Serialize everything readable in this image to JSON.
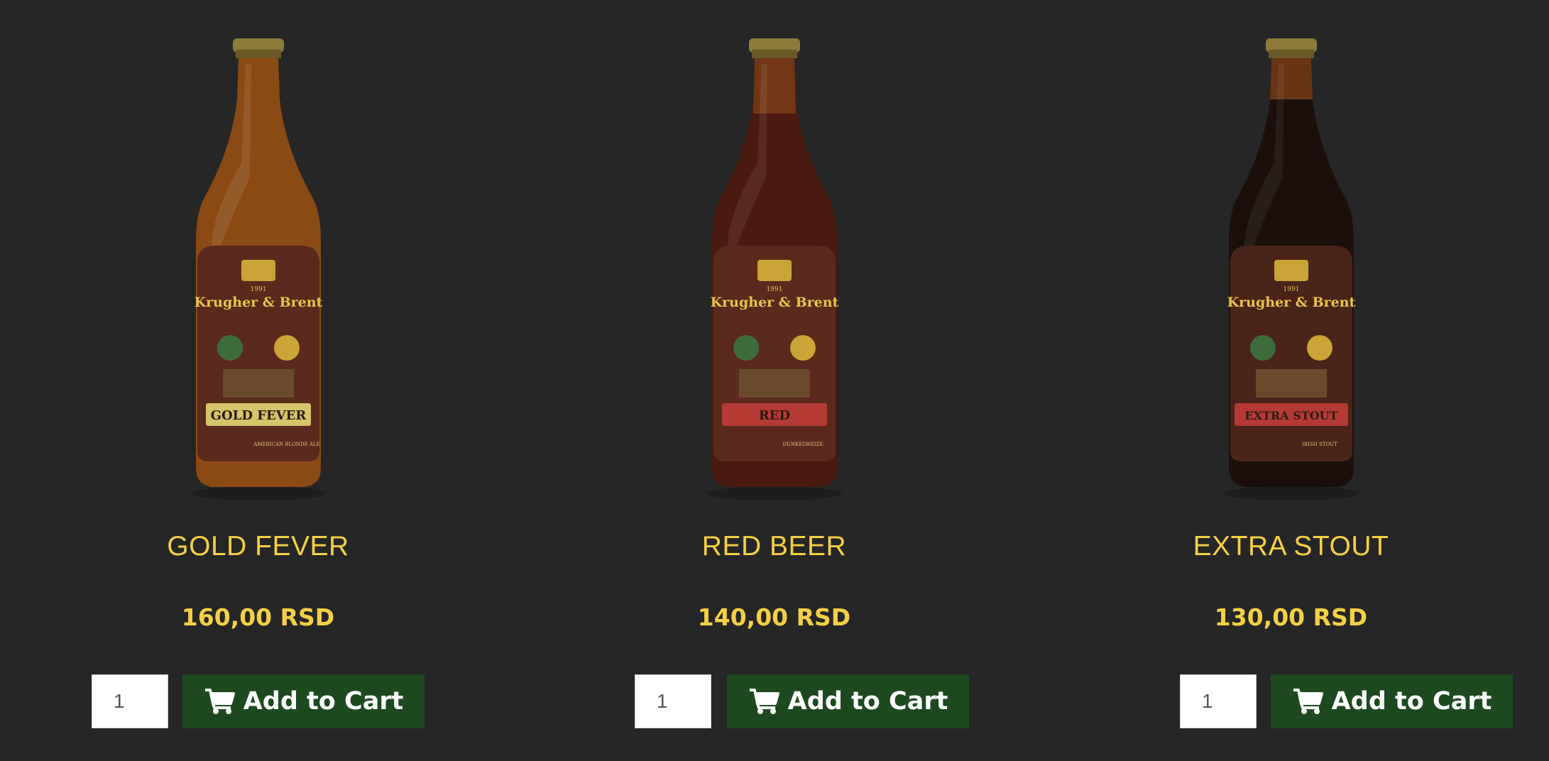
{
  "products": [
    {
      "name": "GOLD FEVER",
      "price": "160,00 RSD",
      "quantity": "1",
      "button_label": "Add to Cart",
      "bottle_color": "#8a4a14",
      "label_banner_text": "GOLD FEVER",
      "label_banner_color": "#d6c46a",
      "label_bottom_text": "AMERICAN BLONDE ALE"
    },
    {
      "name": "RED BEER",
      "price": "140,00 RSD",
      "quantity": "1",
      "button_label": "Add to Cart",
      "bottle_color": "#4a1a10",
      "label_banner_text": "RED",
      "label_banner_color": "#b53a33",
      "label_bottom_text": "DUNKELWEIZE"
    },
    {
      "name": "EXTRA STOUT",
      "price": "130,00 RSD",
      "quantity": "1",
      "button_label": "Add to Cart",
      "bottle_color": "#1c0f0b",
      "label_banner_text": "EXTRA STOUT",
      "label_banner_color": "#b53a33",
      "label_bottom_text": "IRISH STOUT"
    }
  ],
  "brand": {
    "name": "Krugher & Brent",
    "year": "1991"
  },
  "colors": {
    "background": "#262626",
    "accent": "#f5d045",
    "button": "#1c4a1e"
  },
  "icons": {
    "cart": "shopping-cart-icon"
  }
}
